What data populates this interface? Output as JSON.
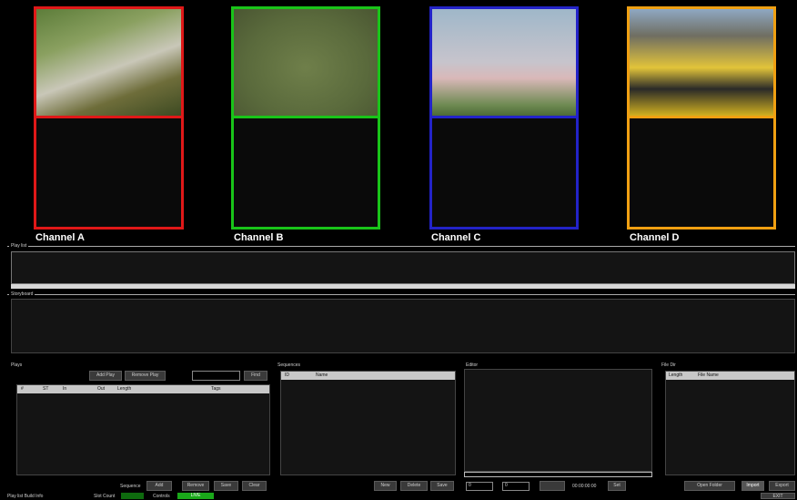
{
  "channels": [
    {
      "label": "Channel A",
      "color": "#e01818"
    },
    {
      "label": "Channel B",
      "color": "#19c419"
    },
    {
      "label": "Channel C",
      "color": "#2323c8"
    },
    {
      "label": "Channel D",
      "color": "#f0a012"
    }
  ],
  "sections": {
    "playlist": "Play list",
    "storyboard": "Storyboard",
    "plays": "Plays",
    "sequences": "Sequences",
    "editor": "Editor",
    "file_dir": "File Dir"
  },
  "plays": {
    "btn1": "Add Play",
    "btn2": "Remove Play",
    "search_btn": "Find",
    "search_value": "",
    "columns": [
      "#",
      "ST",
      "In",
      "Out",
      "Length",
      "",
      "Tags"
    ],
    "seq_label": "Sequence",
    "bottom_btns": [
      "Add",
      "Remove",
      "Save",
      "Clear"
    ]
  },
  "sequences": {
    "columns": [
      "ID",
      "Name"
    ],
    "buttons": [
      "New",
      "Delete",
      "Save"
    ]
  },
  "editor": {
    "timecode": "00:00:00:00",
    "spin1": "0",
    "spin2": "0",
    "btn": "Set"
  },
  "file_dir": {
    "columns": [
      "Length",
      "File Name"
    ],
    "buttons": [
      "Open Folder",
      "Import",
      "Export"
    ]
  },
  "status": {
    "left": "Play list  Build  Info",
    "field_label": "Slot Count",
    "field_value": "",
    "live_label": "Controls",
    "live_value": "LIVE",
    "right_btn": "EXIT"
  },
  "colors": {
    "live": "#1aa81a"
  }
}
